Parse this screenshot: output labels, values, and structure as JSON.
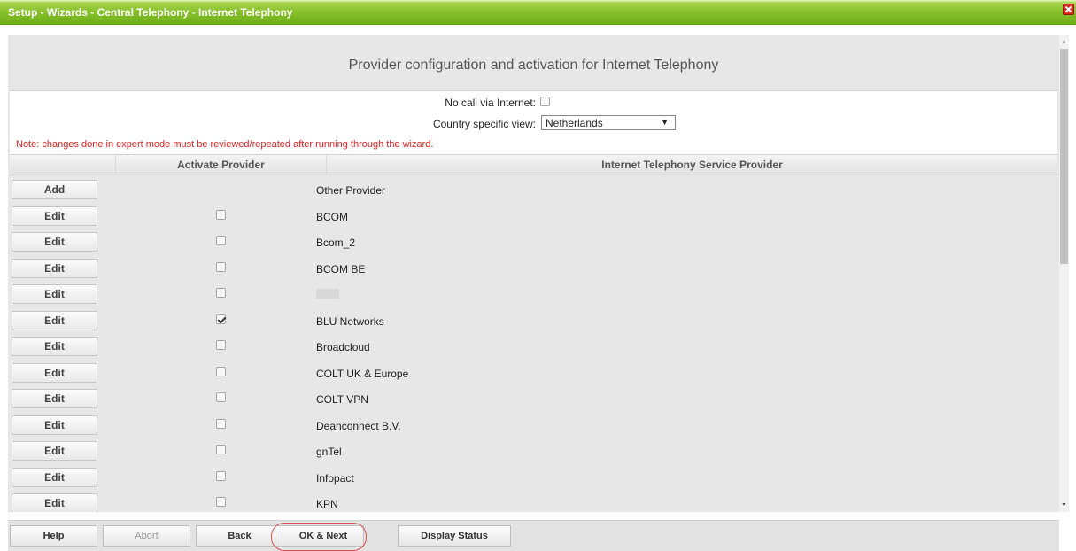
{
  "window": {
    "title": "Setup - Wizards - Central Telephony - Internet Telephony"
  },
  "page": {
    "heading": "Provider configuration and activation for Internet Telephony"
  },
  "settings": {
    "no_call_label": "No call via Internet:",
    "no_call_checked": false,
    "country_label": "Country specific view:",
    "country_value": "Netherlands",
    "note": "Note: changes done in expert mode must be reviewed/repeated after running through the wizard."
  },
  "table": {
    "headers": [
      "",
      "Activate Provider",
      "Internet Telephony Service Provider"
    ],
    "rows": [
      {
        "button": "Add",
        "has_checkbox": false,
        "checked": false,
        "provider": "Other Provider"
      },
      {
        "button": "Edit",
        "has_checkbox": true,
        "checked": false,
        "provider": "BCOM"
      },
      {
        "button": "Edit",
        "has_checkbox": true,
        "checked": false,
        "provider": "Bcom_2"
      },
      {
        "button": "Edit",
        "has_checkbox": true,
        "checked": false,
        "provider": "BCOM BE"
      },
      {
        "button": "Edit",
        "has_checkbox": true,
        "checked": false,
        "provider": ""
      },
      {
        "button": "Edit",
        "has_checkbox": true,
        "checked": true,
        "provider": "BLU Networks"
      },
      {
        "button": "Edit",
        "has_checkbox": true,
        "checked": false,
        "provider": "Broadcloud"
      },
      {
        "button": "Edit",
        "has_checkbox": true,
        "checked": false,
        "provider": "COLT UK & Europe"
      },
      {
        "button": "Edit",
        "has_checkbox": true,
        "checked": false,
        "provider": "COLT VPN"
      },
      {
        "button": "Edit",
        "has_checkbox": true,
        "checked": false,
        "provider": "Deanconnect B.V."
      },
      {
        "button": "Edit",
        "has_checkbox": true,
        "checked": false,
        "provider": "gnTel"
      },
      {
        "button": "Edit",
        "has_checkbox": true,
        "checked": false,
        "provider": "Infopact"
      },
      {
        "button": "Edit",
        "has_checkbox": true,
        "checked": false,
        "provider": "KPN"
      }
    ]
  },
  "footer": {
    "help": "Help",
    "abort": "Abort",
    "back": "Back",
    "ok_next": "OK & Next",
    "display_status": "Display Status"
  },
  "icons": {
    "close": "close-icon",
    "dropdown": "chevron-down-icon",
    "scroll_up": "arrow-up-icon",
    "scroll_down": "arrow-down-icon"
  },
  "colors": {
    "title_bar": "#7dba22",
    "note_text": "#e02020",
    "highlight_ring": "#d9534f"
  }
}
